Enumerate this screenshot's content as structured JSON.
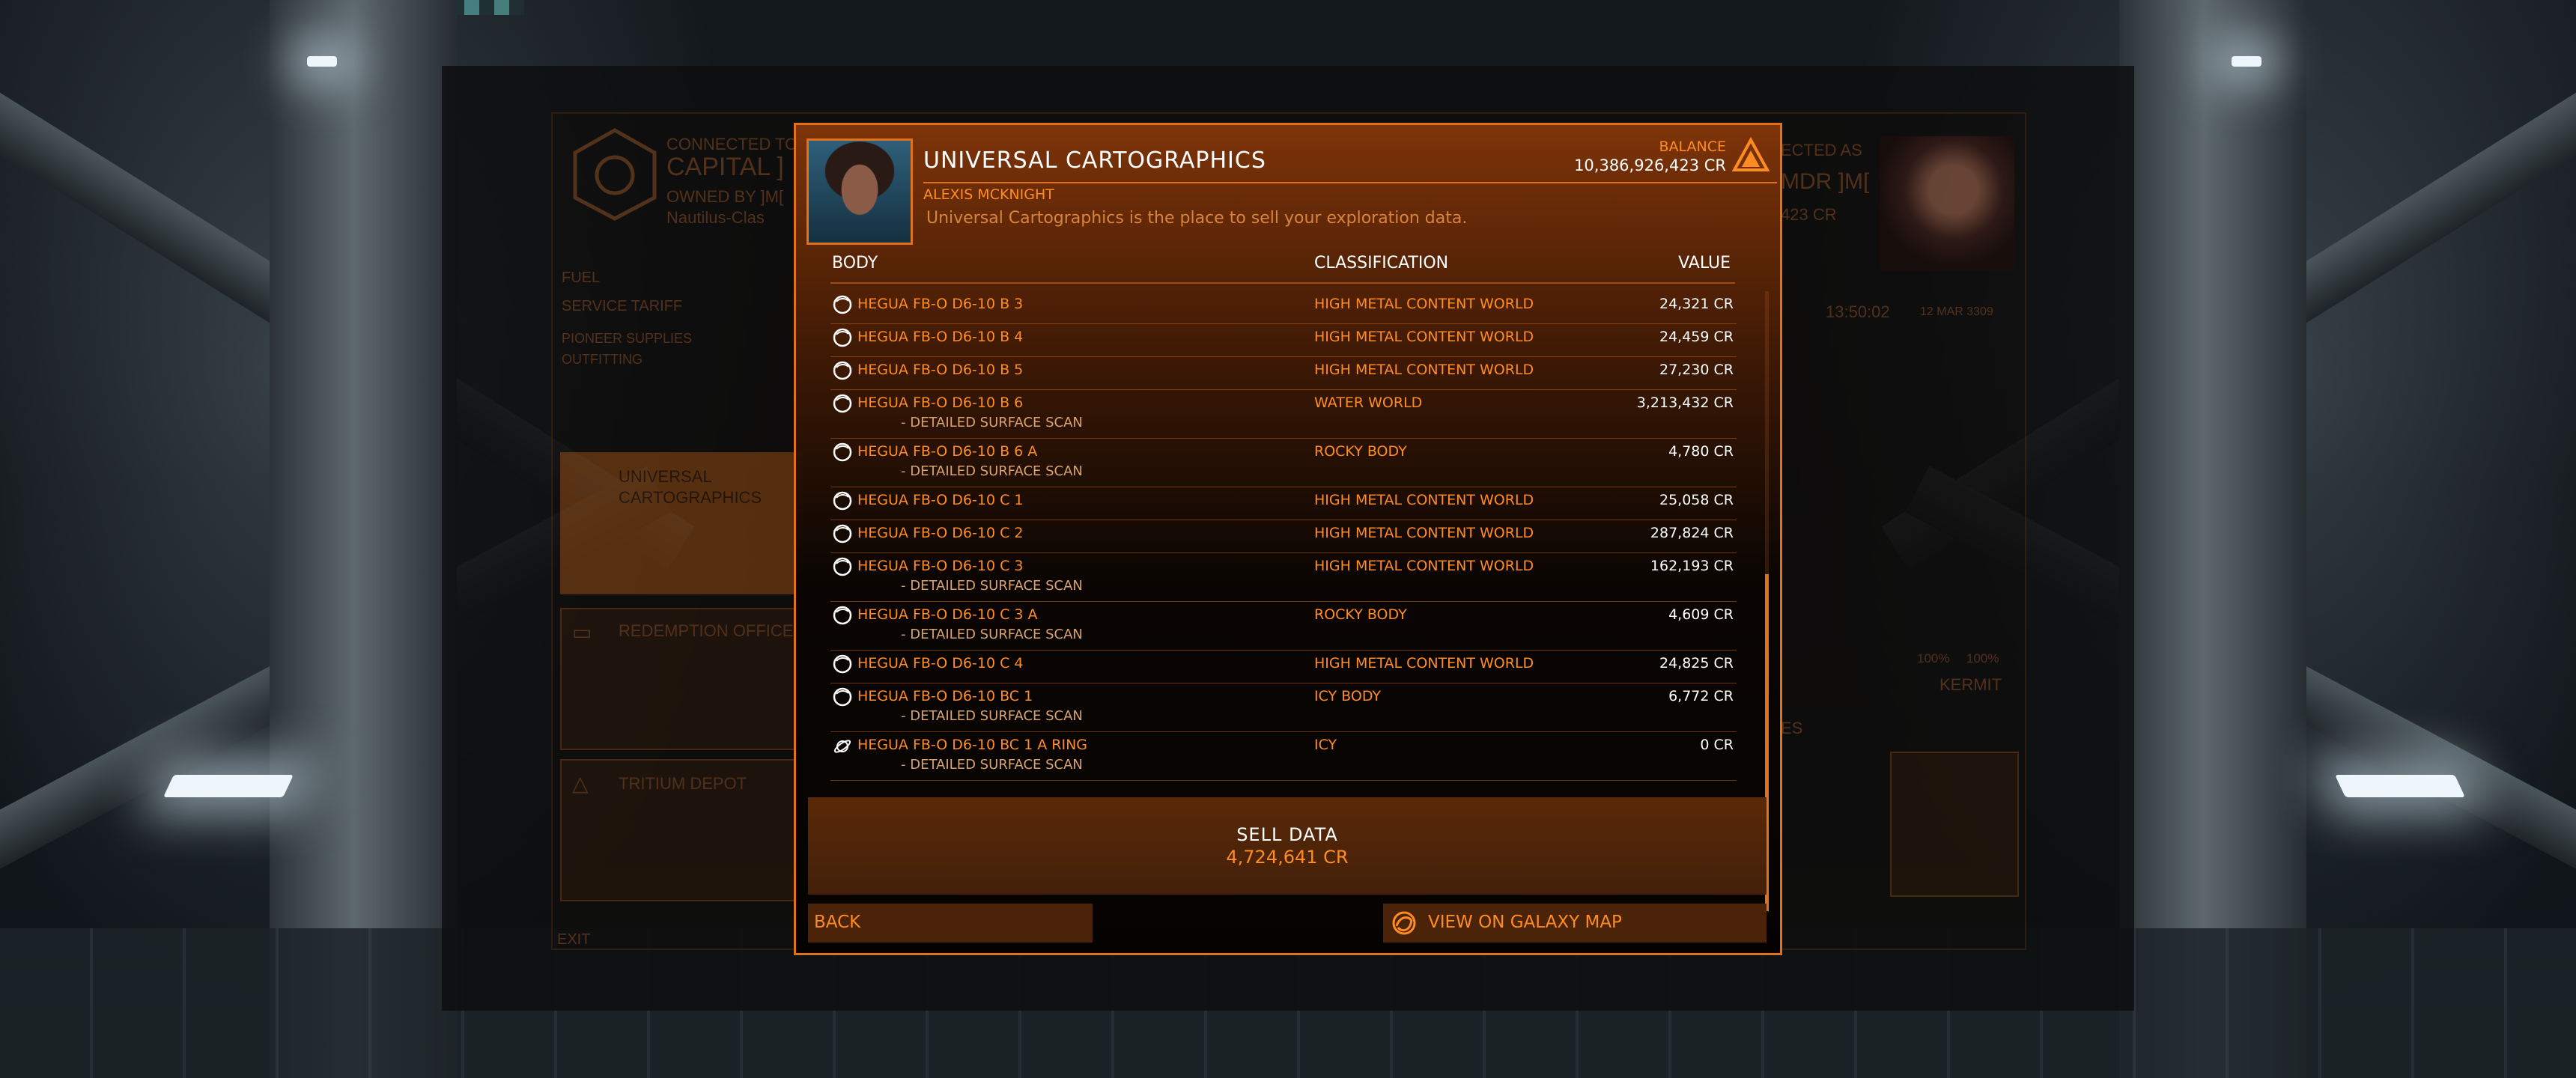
{
  "background_station": {
    "connected_to_label": "CONNECTED TO",
    "station_name": "CAPITAL ]",
    "owned_by": "OWNED BY ]M[",
    "station_class": "Nautilus-Clas",
    "menu_items": [
      "FUEL",
      "SERVICE TARIFF",
      "PIONEER SUPPLIES",
      "OUTFITTING"
    ],
    "cards": [
      {
        "label_line1": "UNIVERSAL",
        "label_line2": "CARTOGRAPHICS"
      },
      {
        "label_line1": "REDEMPTION OFFICE",
        "label_line2": ""
      },
      {
        "label_line1": "TRITIUM DEPOT",
        "label_line2": ""
      }
    ],
    "exit_label": "EXIT",
    "commander_connected": "ECTED AS",
    "commander_name": "MDR ]M[",
    "commander_credits": "423 CR",
    "clock": "13:50:02",
    "date": "12 MAR 3309",
    "fuel_pct": "100%",
    "hull_pct": "100%",
    "ship_name": "KERMIT",
    "services_label": "ES"
  },
  "modal": {
    "title": "UNIVERSAL CARTOGRAPHICS",
    "contact_name": "ALEXIS MCKNIGHT",
    "description": "Universal Cartographics is the place to sell your exploration data.",
    "balance_label": "BALANCE",
    "balance_value": "10,386,926,423 CR",
    "columns": {
      "body": "BODY",
      "classification": "CLASSIFICATION",
      "value": "VALUE"
    },
    "rows": [
      {
        "name": "HEGUA FB-O D6-10 B 3",
        "sub": "",
        "classification": "HIGH METAL CONTENT WORLD",
        "value": "24,321 CR",
        "icon": "planet-icon"
      },
      {
        "name": "HEGUA FB-O D6-10 B 4",
        "sub": "",
        "classification": "HIGH METAL CONTENT WORLD",
        "value": "24,459 CR",
        "icon": "planet-icon"
      },
      {
        "name": "HEGUA FB-O D6-10 B 5",
        "sub": "",
        "classification": "HIGH METAL CONTENT WORLD",
        "value": "27,230 CR",
        "icon": "planet-icon"
      },
      {
        "name": "HEGUA FB-O D6-10 B 6",
        "sub": "- DETAILED SURFACE SCAN",
        "classification": "WATER WORLD",
        "value": "3,213,432 CR",
        "icon": "planet-icon"
      },
      {
        "name": "HEGUA FB-O D6-10 B 6 A",
        "sub": "- DETAILED SURFACE SCAN",
        "classification": "ROCKY BODY",
        "value": "4,780 CR",
        "icon": "planet-icon"
      },
      {
        "name": "HEGUA FB-O D6-10 C 1",
        "sub": "",
        "classification": "HIGH METAL CONTENT WORLD",
        "value": "25,058 CR",
        "icon": "planet-icon"
      },
      {
        "name": "HEGUA FB-O D6-10 C 2",
        "sub": "",
        "classification": "HIGH METAL CONTENT WORLD",
        "value": "287,824 CR",
        "icon": "planet-icon"
      },
      {
        "name": "HEGUA FB-O D6-10 C 3",
        "sub": "- DETAILED SURFACE SCAN",
        "classification": "HIGH METAL CONTENT WORLD",
        "value": "162,193 CR",
        "icon": "planet-icon"
      },
      {
        "name": "HEGUA FB-O D6-10 C 3 A",
        "sub": "- DETAILED SURFACE SCAN",
        "classification": "ROCKY BODY",
        "value": "4,609 CR",
        "icon": "planet-icon"
      },
      {
        "name": "HEGUA FB-O D6-10 C 4",
        "sub": "",
        "classification": "HIGH METAL CONTENT WORLD",
        "value": "24,825 CR",
        "icon": "planet-icon"
      },
      {
        "name": "HEGUA FB-O D6-10 BC 1",
        "sub": "- DETAILED SURFACE SCAN",
        "classification": "ICY BODY",
        "value": "6,772 CR",
        "icon": "planet-icon"
      },
      {
        "name": "HEGUA FB-O D6-10 BC 1 A RING",
        "sub": "- DETAILED SURFACE SCAN",
        "classification": "ICY",
        "value": "0 CR",
        "icon": "ring-icon"
      }
    ],
    "sell_label": "SELL DATA",
    "sell_value": "4,724,641 CR",
    "back_label": "BACK",
    "galaxy_map_label": "VIEW ON GALAXY MAP"
  },
  "colors": {
    "accent": "#e2711b",
    "text_orange": "#ff8c22",
    "text_white": "#ffffff"
  }
}
